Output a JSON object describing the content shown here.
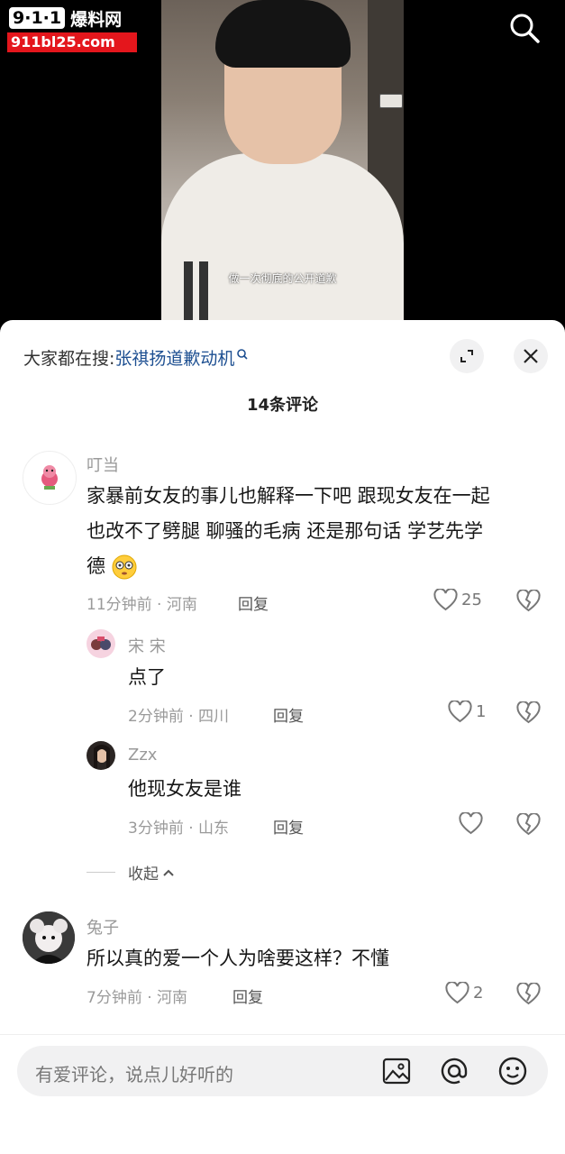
{
  "watermark": {
    "brand_short": "9·1·1",
    "brand_cn": "爆料网",
    "url": "911bl25.com"
  },
  "video": {
    "subtitle": "做一次彻底的公开道歉"
  },
  "sheet": {
    "search_hint_prefix": "大家都在搜:",
    "search_hint_link": "张祺扬道歉动机",
    "comment_count": "14条评论"
  },
  "comments": [
    {
      "user": "叮当",
      "text_line1": "家暴前女友的事儿也解释一下吧 跟现女友在一起",
      "text_line2": "也改不了劈腿 聊骚的毛病  还是那句话 学艺先学",
      "text_line3": "德",
      "meta": "11分钟前 · 河南",
      "reply_label": "回复",
      "likes": "25"
    },
    {
      "user": "宋 宋",
      "text": "点了",
      "meta": "2分钟前 · 四川",
      "reply_label": "回复",
      "likes": "1"
    },
    {
      "user": "Zzx",
      "text": "他现女友是谁",
      "meta": "3分钟前 · 山东",
      "reply_label": "回复",
      "likes": ""
    },
    {
      "user": "兔子",
      "text": "所以真的爱一个人为啥要这样？不懂",
      "meta": "7分钟前 · 河南",
      "reply_label": "回复",
      "likes": "2"
    }
  ],
  "collapse_label": "收起",
  "input": {
    "placeholder": "有爱评论，说点儿好听的"
  },
  "icons": [
    "search-icon",
    "expand-icon",
    "close-icon",
    "heart-icon",
    "broken-heart-icon",
    "chevron-up-icon",
    "image-icon",
    "at-icon",
    "emoji-icon",
    "flushed-emoji-icon"
  ]
}
